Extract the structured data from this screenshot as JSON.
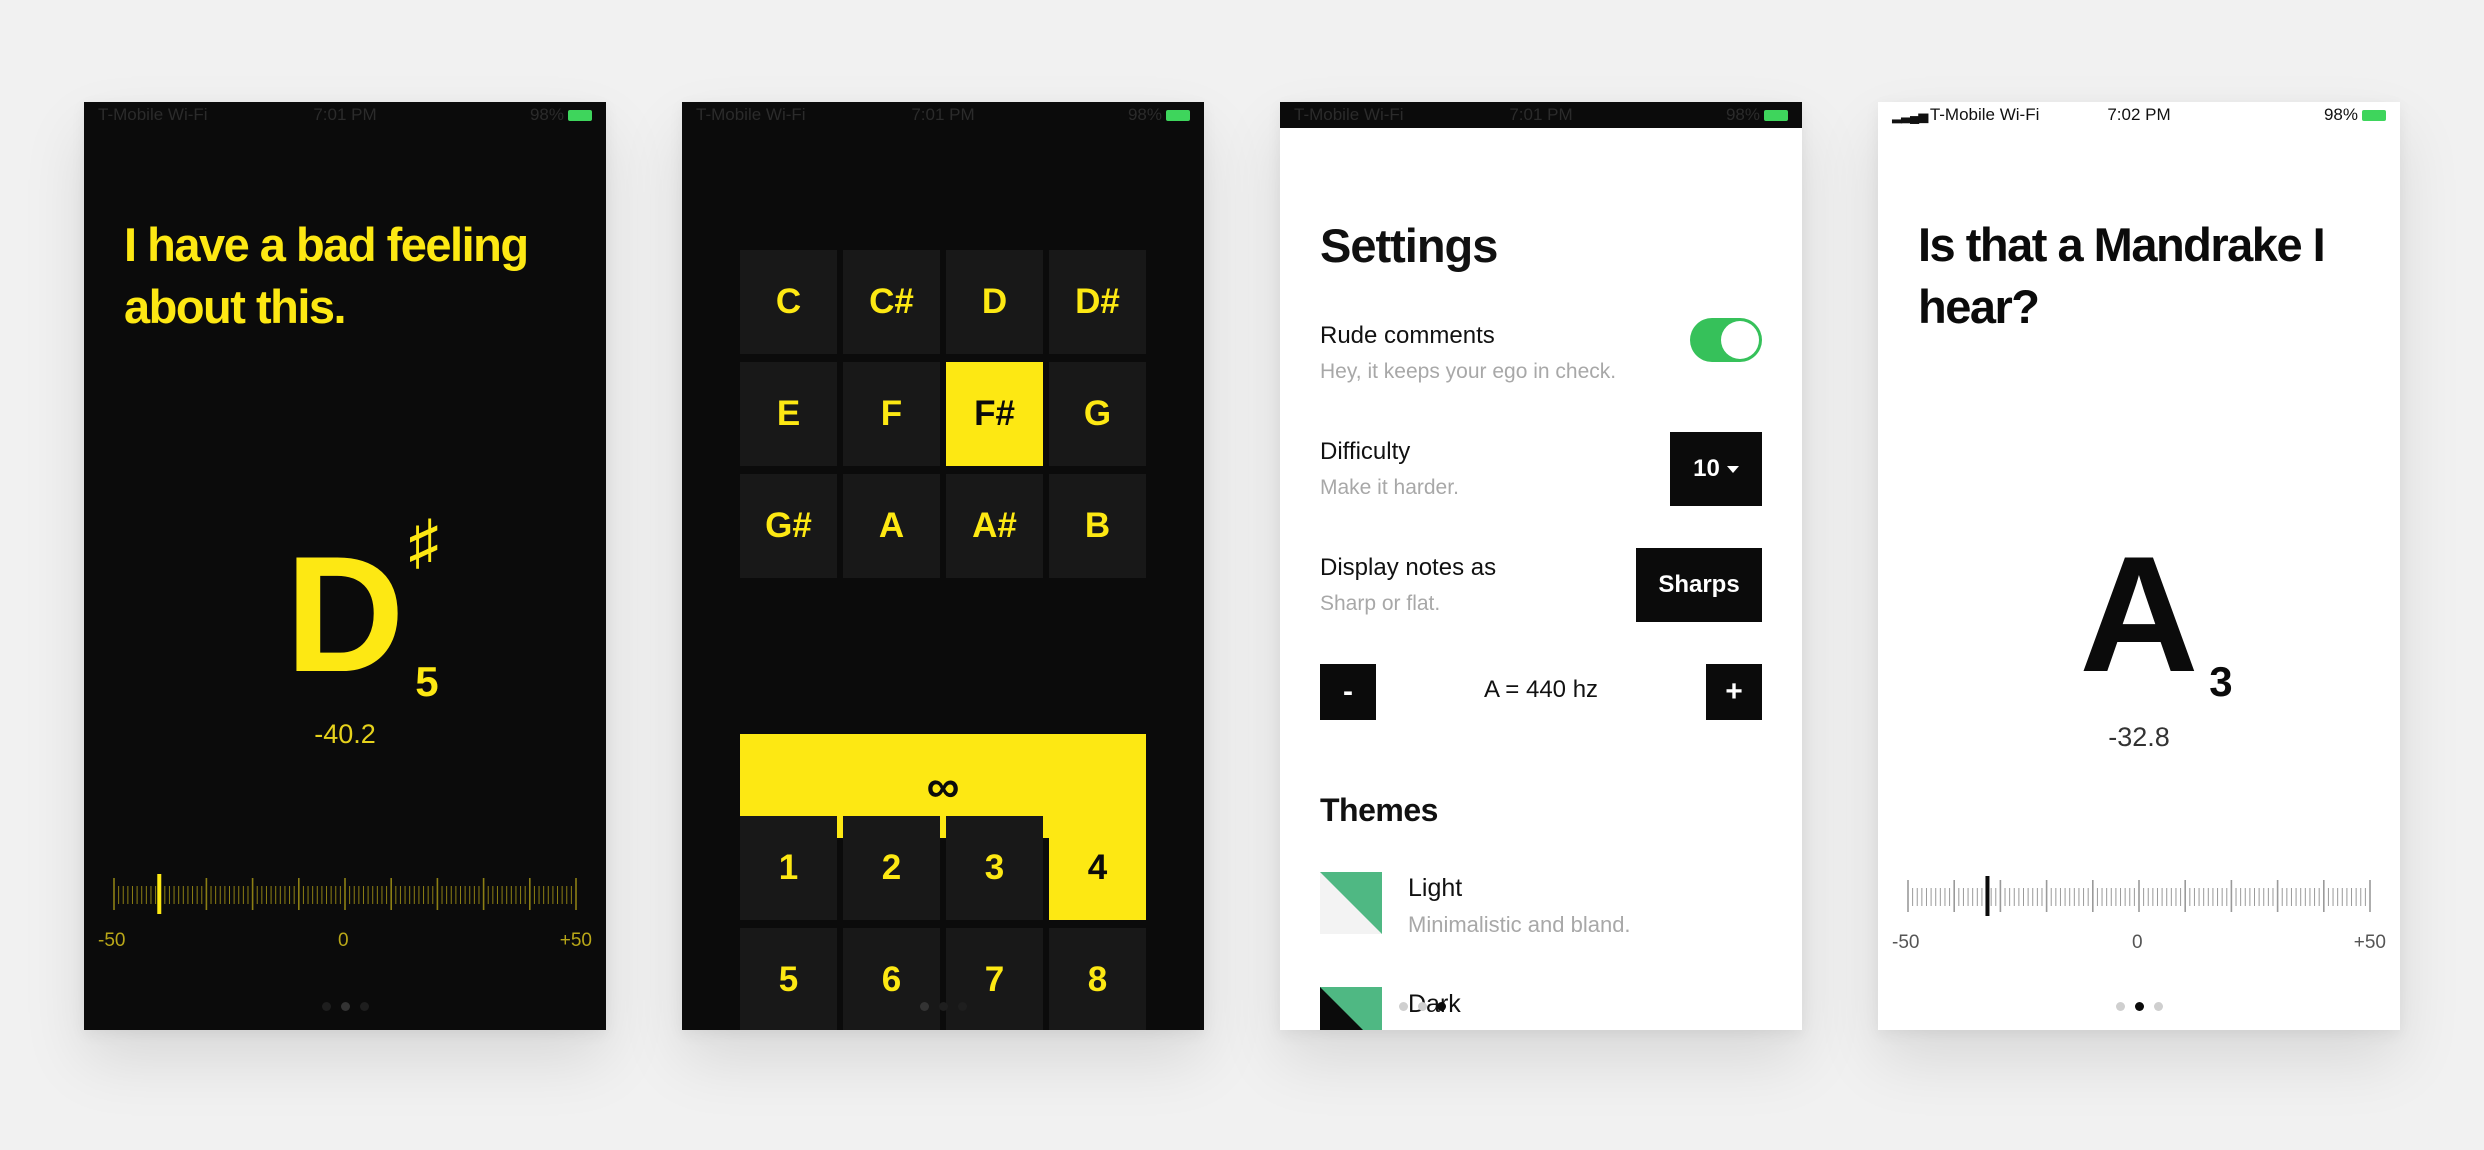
{
  "colors": {
    "accent_yellow": "#fde813",
    "dark_bg": "#0b0b0b",
    "toggle_green": "#36c15a",
    "theme_green": "#4fb883"
  },
  "status": {
    "carrier": "T-Mobile Wi-Fi",
    "time": "7:02 PM",
    "battery": "98%"
  },
  "status_dim": {
    "carrier": "T-Mobile Wi-Fi",
    "time": "7:01 PM",
    "battery": "98%"
  },
  "tuner_dark": {
    "headline": "I have a bad feeling about this.",
    "note": "D",
    "accidental": "♯",
    "octave": "5",
    "cents": "-40.2",
    "needle_position": -40.2,
    "meter": {
      "min_label": "-50",
      "mid_label": "0",
      "max_label": "+50"
    },
    "page_index": 1
  },
  "note_picker": {
    "notes": [
      "C",
      "C#",
      "D",
      "D#",
      "E",
      "F",
      "F#",
      "G",
      "G#",
      "A",
      "A#",
      "B"
    ],
    "selected_note": "F#",
    "infinity_label": "∞",
    "counts": [
      "1",
      "2",
      "3",
      "4",
      "5",
      "6",
      "7",
      "8"
    ],
    "selected_count": "4",
    "page_index": 0
  },
  "settings": {
    "title": "Settings",
    "rude_comments": {
      "label": "Rude comments",
      "description": "Hey, it keeps your ego in check.",
      "enabled": true
    },
    "difficulty": {
      "label": "Difficulty",
      "description": "Make it harder.",
      "value": "10"
    },
    "display_notes": {
      "label": "Display notes as",
      "description": "Sharp or flat.",
      "value": "Sharps"
    },
    "reference": {
      "decrement_label": "-",
      "value": "A = 440 hz",
      "increment_label": "+"
    },
    "themes_heading": "Themes",
    "themes": [
      {
        "name": "Light",
        "description": "Minimalistic and bland."
      },
      {
        "name": "Dark",
        "description": ""
      }
    ],
    "page_index": 2
  },
  "tuner_light": {
    "headline": "Is that a Mandrake I hear?",
    "note": "A",
    "octave": "3",
    "cents": "-32.8",
    "needle_position": -32.8,
    "meter": {
      "min_label": "-50",
      "mid_label": "0",
      "max_label": "+50"
    },
    "page_index": 1
  }
}
